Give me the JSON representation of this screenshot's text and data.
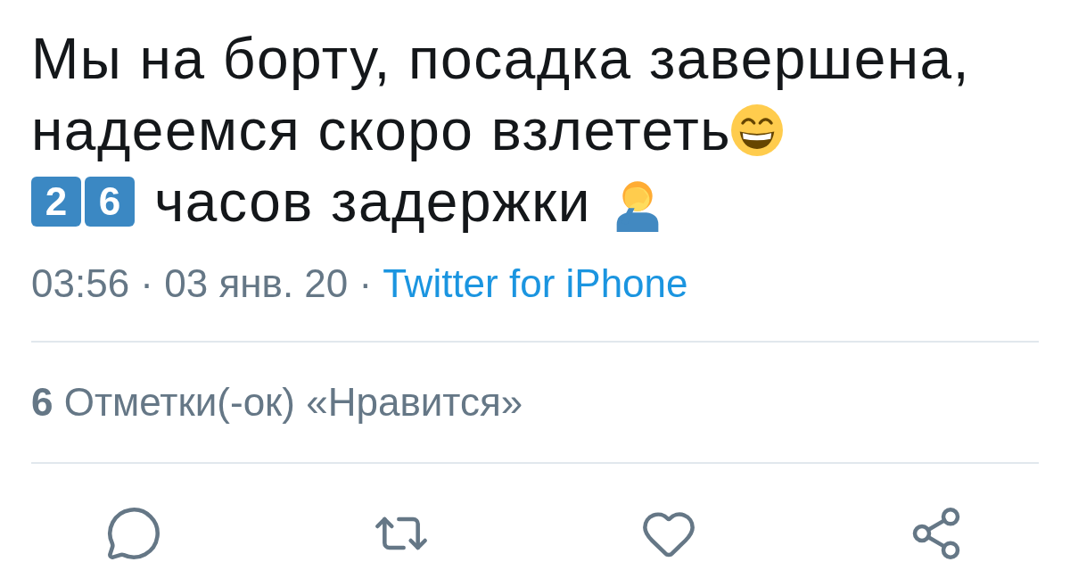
{
  "tweet": {
    "lines": [
      {
        "parts": [
          {
            "kind": "text",
            "text": "Мы на борту, посадка завершена,"
          }
        ]
      },
      {
        "parts": [
          {
            "kind": "text",
            "text": "надеемся скоро взлететь"
          },
          {
            "kind": "grin"
          }
        ]
      },
      {
        "parts": [
          {
            "kind": "keycap",
            "text": "2"
          },
          {
            "kind": "keycap",
            "text": "6"
          },
          {
            "kind": "text",
            "text": "часов задержки"
          },
          {
            "kind": "facepalm"
          }
        ]
      }
    ],
    "timestamp": "03:56 · 03 янв. 20 ·",
    "source": "Twitter for iPhone"
  },
  "likes": "**6** Отметки(-ок) «Нравится»"
}
